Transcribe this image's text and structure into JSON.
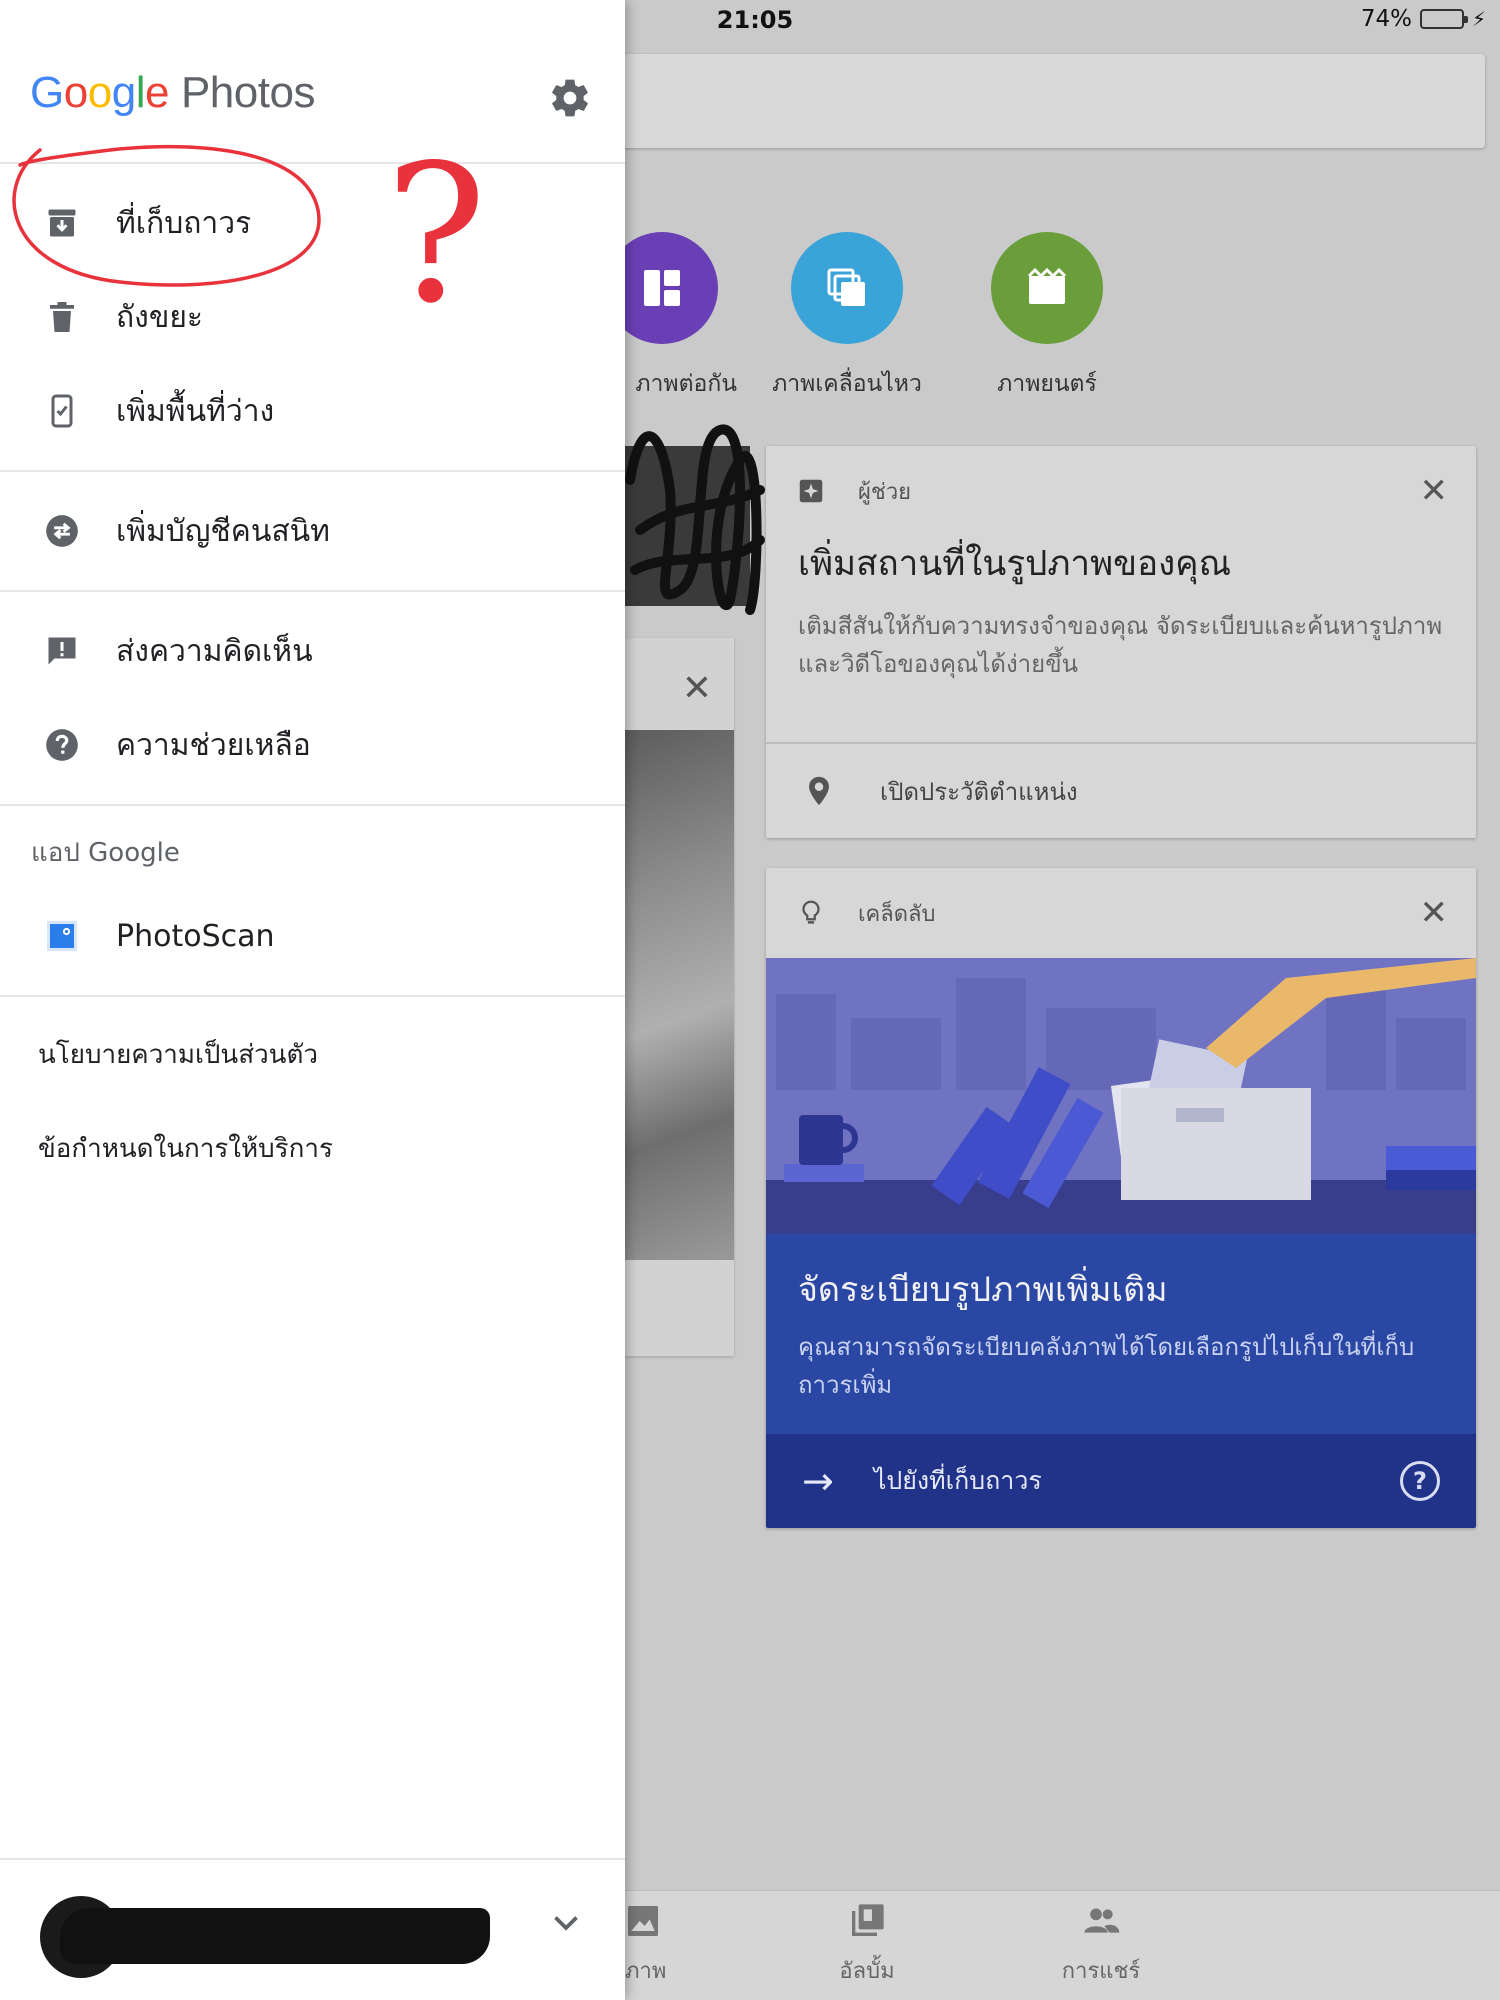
{
  "status_bar": {
    "time": "21:05",
    "battery": "74%",
    "battery_level": 0.74,
    "battery_color": "#34c759"
  },
  "creations": [
    {
      "label": "ภาพต่อกัน",
      "color": "#6a3fb5",
      "icon": "collage-icon"
    },
    {
      "label": "ภาพเคลื่อนไหว",
      "color": "#3aa3d8",
      "icon": "animation-icon"
    },
    {
      "label": "ภาพยนตร์",
      "color": "#6a9e3a",
      "icon": "movie-icon"
    }
  ],
  "assistant_card": {
    "kind": "ผู้ช่วย",
    "title": "เพิ่มสถานที่ในรูปภาพของคุณ",
    "body": "เติมสีสันให้กับความทรงจำของคุณ จัดระเบียบและค้นหารูปภาพและวิดีโอของคุณได้ง่ายขึ้น",
    "action": "เปิดประวัติตำแหน่ง"
  },
  "tips_card": {
    "kind": "เคล็ดลับ",
    "title": "จัดระเบียบรูปภาพเพิ่มเติม",
    "body": "คุณสามารถจัดระเบียบคลังภาพได้โดยเลือกรูปไปเก็บในที่เก็บถาวรเพิ่ม",
    "action": "ไปยังที่เก็บถาวร",
    "help": "?"
  },
  "bottom_nav": [
    {
      "label": "ภาพ",
      "icon": "photo-icon"
    },
    {
      "label": "อัลบั้ม",
      "icon": "albums-icon"
    },
    {
      "label": "การแชร์",
      "icon": "sharing-icon"
    }
  ],
  "drawer": {
    "logo_letters": [
      "G",
      "o",
      "o",
      "g",
      "l",
      "e"
    ],
    "product": "Photos",
    "menu_groups": [
      [
        {
          "label": "ที่เก็บถาวร",
          "icon": "archive-icon"
        },
        {
          "label": "ถังขยะ",
          "icon": "trash-icon"
        },
        {
          "label": "เพิ่มพื้นที่ว่าง",
          "icon": "free-up-space-icon"
        }
      ],
      [
        {
          "label": "เพิ่มบัญชีคนสนิท",
          "icon": "partner-sharing-icon"
        }
      ],
      [
        {
          "label": "ส่งความคิดเห็น",
          "icon": "feedback-icon"
        },
        {
          "label": "ความช่วยเหลือ",
          "icon": "help-icon"
        }
      ]
    ],
    "apps_section_title": "แอป Google",
    "apps": [
      {
        "label": "PhotoScan",
        "icon": "photoscan-icon"
      }
    ],
    "links": [
      "นโยบายความเป็นส่วนตัว",
      "ข้อกำหนดในการให้บริการ"
    ]
  },
  "annotation": {
    "mark": "?",
    "color": "#e8323c"
  }
}
